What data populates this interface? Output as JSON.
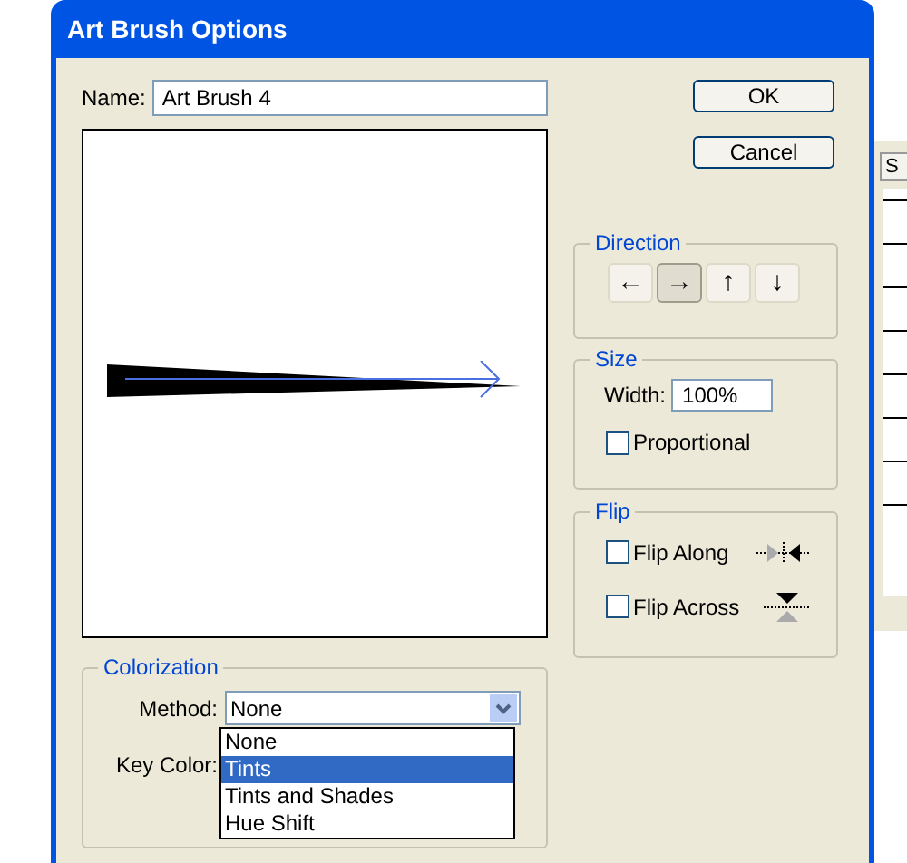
{
  "window": {
    "title": "Art Brush Options"
  },
  "name": {
    "label": "Name:",
    "value": "Art Brush 4"
  },
  "buttons": [
    "OK",
    "Cancel"
  ],
  "direction": {
    "title": "Direction",
    "options": [
      {
        "symbol": "←",
        "selected": false
      },
      {
        "symbol": "→",
        "selected": true
      },
      {
        "symbol": "↑",
        "selected": false
      },
      {
        "symbol": "↓",
        "selected": false
      }
    ]
  },
  "size": {
    "title": "Size",
    "width_label": "Width:",
    "width_value": "100%",
    "proportional": {
      "label": "Proportional",
      "checked": false
    }
  },
  "flip": {
    "title": "Flip",
    "options": [
      {
        "label": "Flip Along",
        "checked": false,
        "kind": "along"
      },
      {
        "label": "Flip Across",
        "checked": false,
        "kind": "across"
      }
    ]
  },
  "colorization": {
    "title": "Colorization",
    "method_label": "Method:",
    "method_value": "None",
    "key_color_label": "Key Color:",
    "options": [
      {
        "label": "None",
        "selected": false
      },
      {
        "label": "Tints",
        "selected": true
      },
      {
        "label": "Tints and Shades",
        "selected": false
      },
      {
        "label": "Hue Shift",
        "selected": false
      }
    ]
  },
  "background_panel": {
    "tab": "S"
  }
}
